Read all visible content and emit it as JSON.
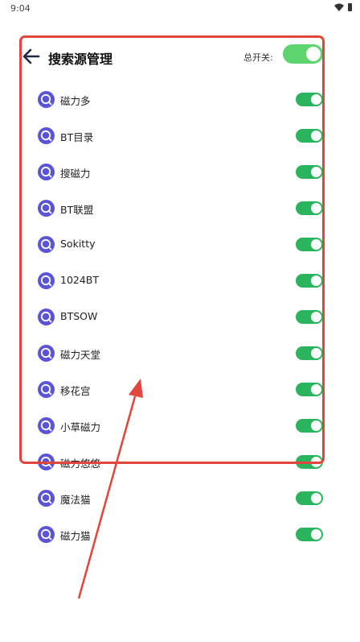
{
  "status": {
    "time": "9:04"
  },
  "header": {
    "title": "搜索源管理",
    "master_label": "总开关:"
  },
  "sources": [
    {
      "name": "磁力多",
      "enabled": true
    },
    {
      "name": "BT目录",
      "enabled": true
    },
    {
      "name": "搜磁力",
      "enabled": true
    },
    {
      "name": "BT联盟",
      "enabled": true
    },
    {
      "name": "Sokitty",
      "enabled": true
    },
    {
      "name": "1024BT",
      "enabled": true
    },
    {
      "name": "BTSOW",
      "enabled": true
    },
    {
      "name": "磁力天堂",
      "enabled": true
    },
    {
      "name": "移花宫",
      "enabled": true
    },
    {
      "name": "小草磁力",
      "enabled": true
    },
    {
      "name": "磁力悠悠",
      "enabled": true
    },
    {
      "name": "魔法猫",
      "enabled": true
    },
    {
      "name": "磁力猫",
      "enabled": true
    }
  ],
  "icons": {
    "back": "arrow-left-icon",
    "source": "search-icon",
    "wifi": "wifi-icon",
    "battery": "battery-icon"
  },
  "colors": {
    "toggle_on": "#2bb35e",
    "master_toggle": "#5dd46d",
    "icon": "#5b54d6",
    "annotation": "#e2453c"
  }
}
